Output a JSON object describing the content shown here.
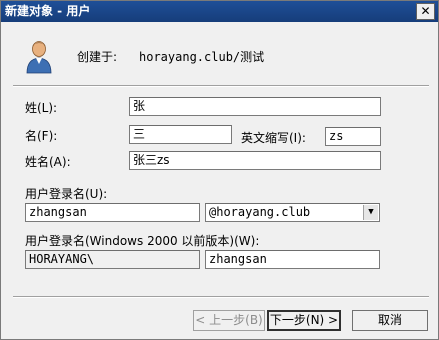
{
  "window": {
    "title": "新建对象 - 用户",
    "close_glyph": "✕"
  },
  "header": {
    "created_in_label": "创建于:",
    "created_in_value": "horayang.club/测试"
  },
  "form": {
    "last_name_label": "姓(L):",
    "last_name_value": "张",
    "first_name_label": "名(F):",
    "first_name_value": "三",
    "initials_label": "英文缩写(I):",
    "initials_value": "zs",
    "full_name_label": "姓名(A):",
    "full_name_value": "张三zs",
    "logon_name_label": "用户登录名(U):",
    "logon_name_value": "zhangsan",
    "domain_value": "@horayang.club",
    "pre2000_label": "用户登录名(Windows 2000 以前版本)(W):",
    "pre2000_domain_value": "HORAYANG\\",
    "pre2000_name_value": "zhangsan"
  },
  "buttons": {
    "back_label": "< 上一步(B)",
    "next_label": "下一步(N) >",
    "cancel_label": "取消"
  }
}
